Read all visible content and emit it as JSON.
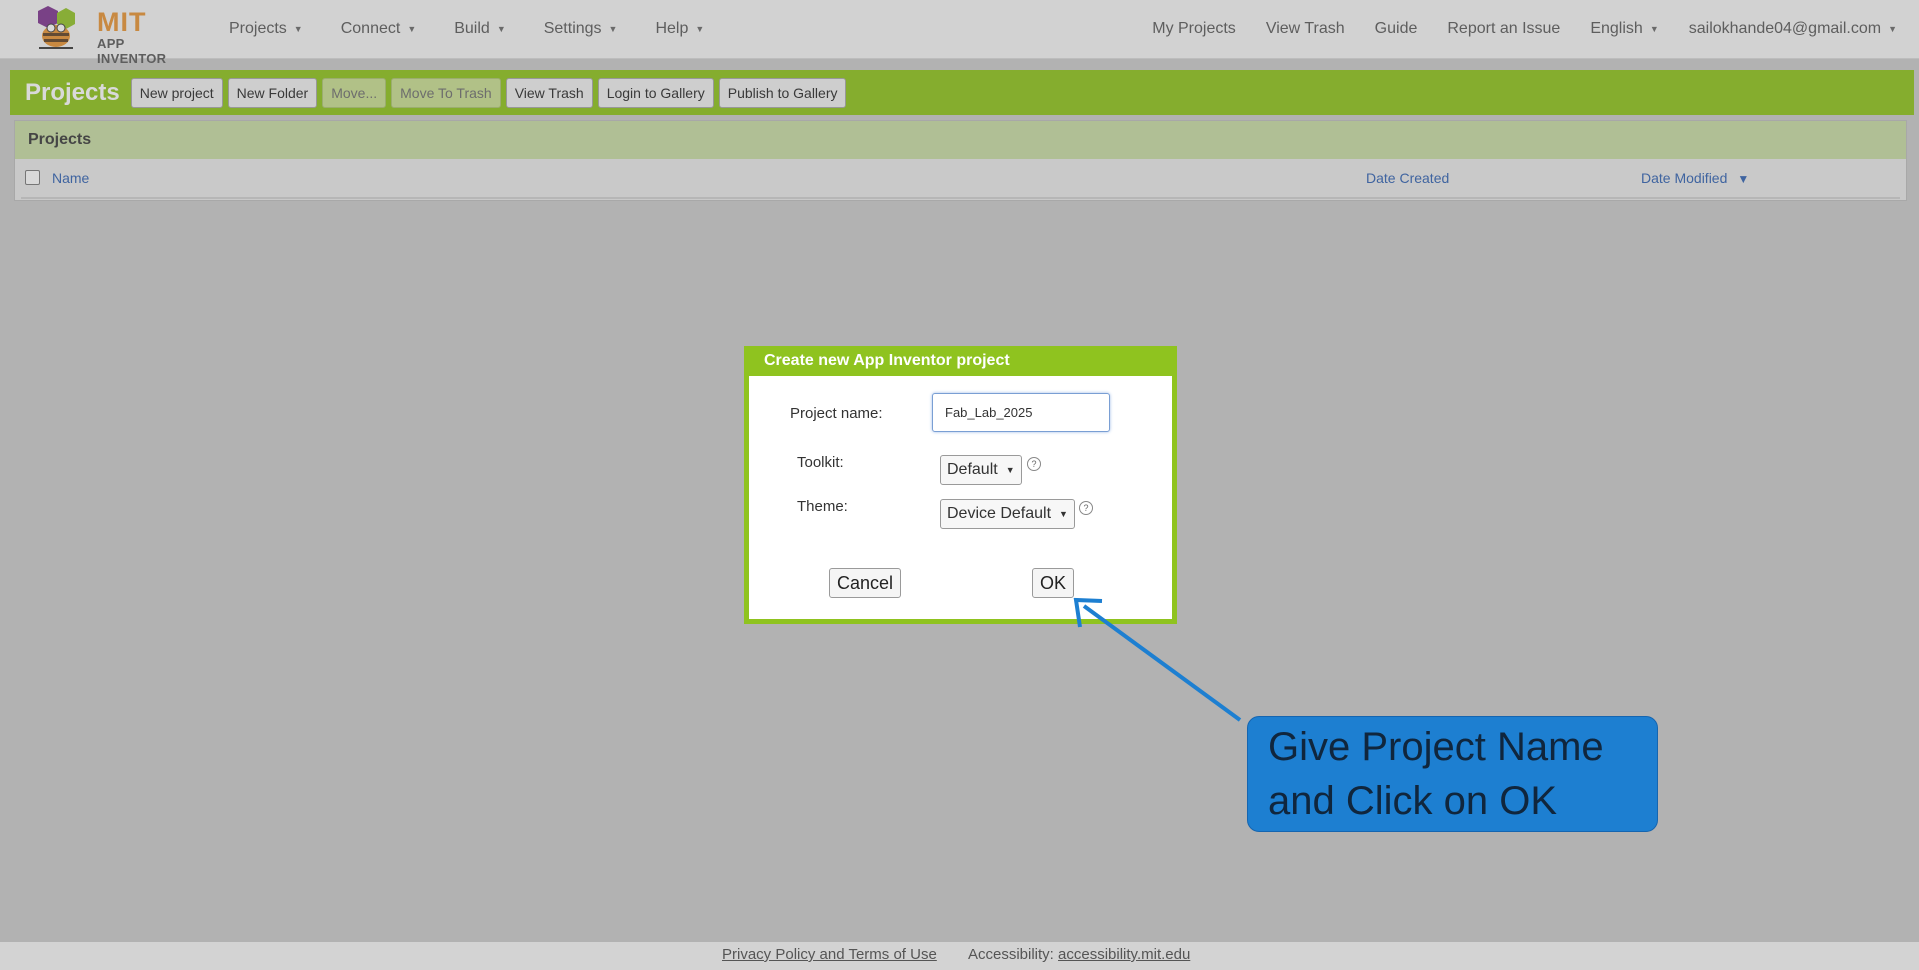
{
  "header": {
    "logo_title": "MIT",
    "logo_subtitle": "APP INVENTOR",
    "nav_left": [
      {
        "label": "Projects"
      },
      {
        "label": "Connect"
      },
      {
        "label": "Build"
      },
      {
        "label": "Settings"
      },
      {
        "label": "Help"
      }
    ],
    "nav_right": {
      "my_projects": "My Projects",
      "view_trash": "View Trash",
      "guide": "Guide",
      "report_issue": "Report an Issue",
      "language": "English",
      "account": "sailokhande04@gmail.com"
    }
  },
  "toolbar": {
    "title": "Projects",
    "buttons": {
      "new_project": "New project",
      "new_folder": "New Folder",
      "move": "Move...",
      "move_to_trash": "Move To Trash",
      "view_trash": "View Trash",
      "login_gallery": "Login to Gallery",
      "publish_gallery": "Publish to Gallery"
    }
  },
  "projects_panel": {
    "title": "Projects",
    "columns": {
      "name": "Name",
      "date_created": "Date Created",
      "date_modified": "Date Modified"
    }
  },
  "dialog": {
    "title": "Create new App Inventor project",
    "project_name_label": "Project name:",
    "project_name_value": "Fab_Lab_2025",
    "toolkit_label": "Toolkit:",
    "toolkit_value": "Default",
    "theme_label": "Theme:",
    "theme_value": "Device Default",
    "cancel": "Cancel",
    "ok": "OK"
  },
  "annotation": {
    "line1": "Give Project Name",
    "line2": "and Click on OK",
    "color": "#1d7fd1"
  },
  "footer": {
    "privacy": "Privacy Policy and Terms of Use",
    "accessibility_label": "Accessibility:",
    "accessibility_link": "accessibility.mit.edu"
  },
  "colors": {
    "brand_green": "#8bc213",
    "logo_orange": "#e8912d"
  }
}
